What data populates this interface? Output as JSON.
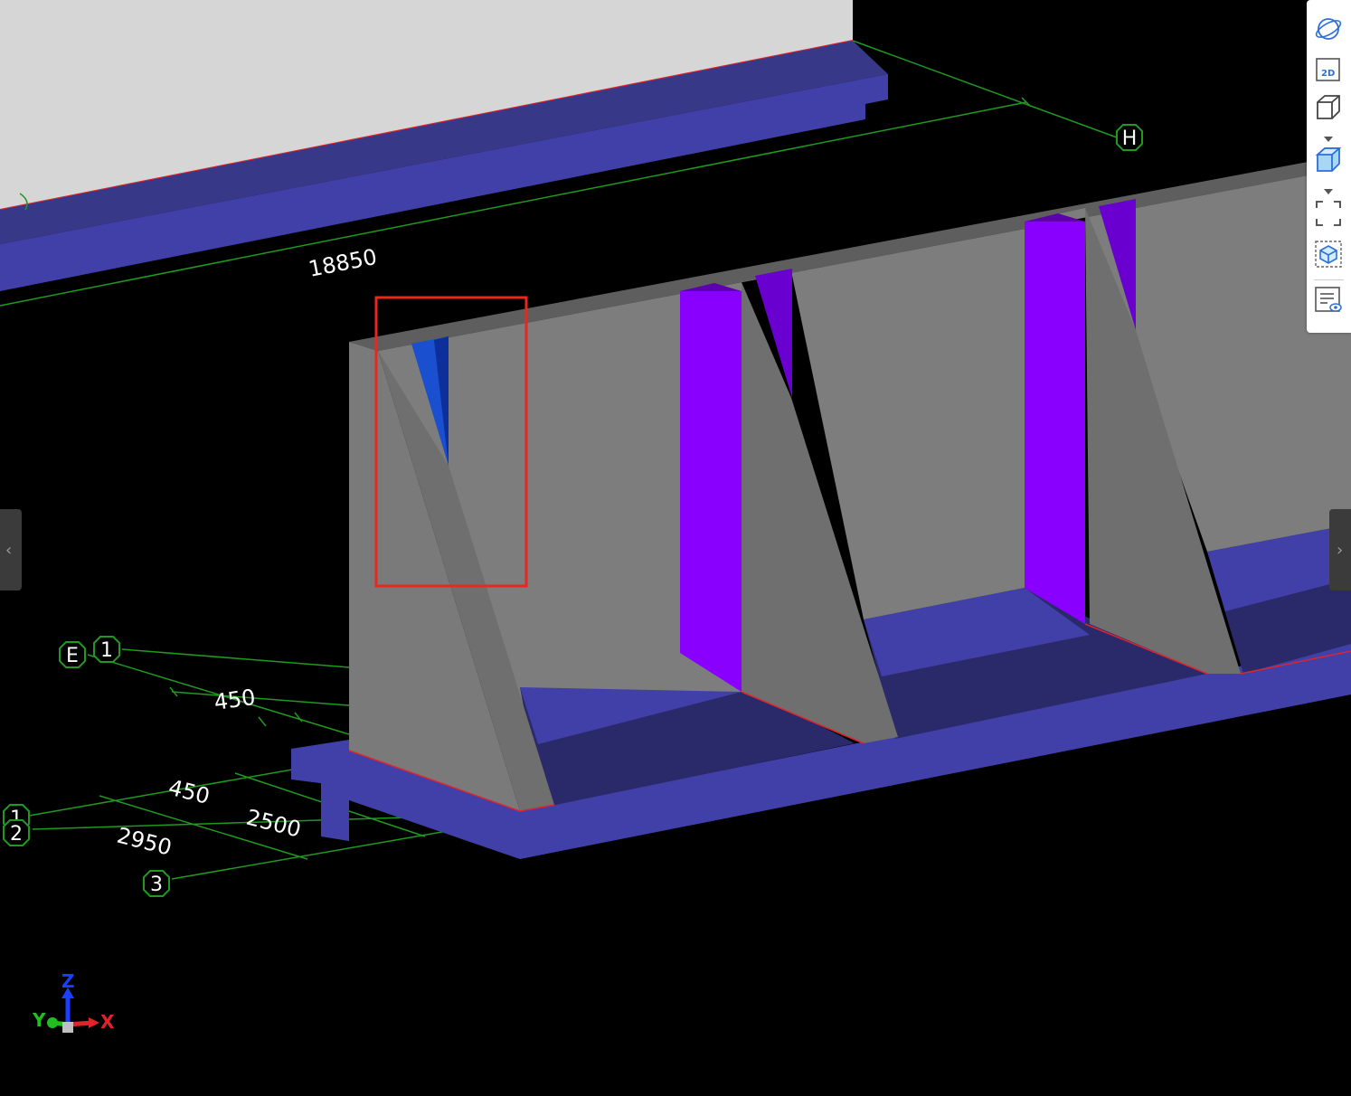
{
  "viewport": {
    "background": "#000000",
    "dimensions": {
      "d18850": "18850",
      "d450a": "450",
      "d450b": "450",
      "d2500": "2500",
      "d2950": "2950"
    },
    "grid_labels": {
      "H": "H",
      "E": "E",
      "one_top": "1",
      "one_left": "1",
      "two_left": "2",
      "three": "3"
    },
    "axes": {
      "z": "Z",
      "y": "Y",
      "x": "X"
    },
    "colors": {
      "concrete": "#7a7a7a",
      "footing": "#4040a8",
      "rib_violet": "#8a00ff",
      "highlight_blue": "#1a4fd0",
      "grid_lines": "#1f9a1f",
      "edge_red": "#e0242a",
      "selection_box": "#e8281f",
      "background_wall": "#d6d6d6"
    }
  },
  "toolbar": {
    "items": [
      {
        "name": "orbit-icon",
        "tooltip": ""
      },
      {
        "name": "view-2d-icon",
        "label": "2D"
      },
      {
        "name": "wireframe-cube-icon"
      },
      {
        "name": "solid-cube-icon"
      },
      {
        "name": "fit-view-icon"
      },
      {
        "name": "section-box-icon"
      },
      {
        "name": "properties-visibility-icon"
      }
    ]
  },
  "handles": {
    "left": "‹",
    "right": "›"
  }
}
